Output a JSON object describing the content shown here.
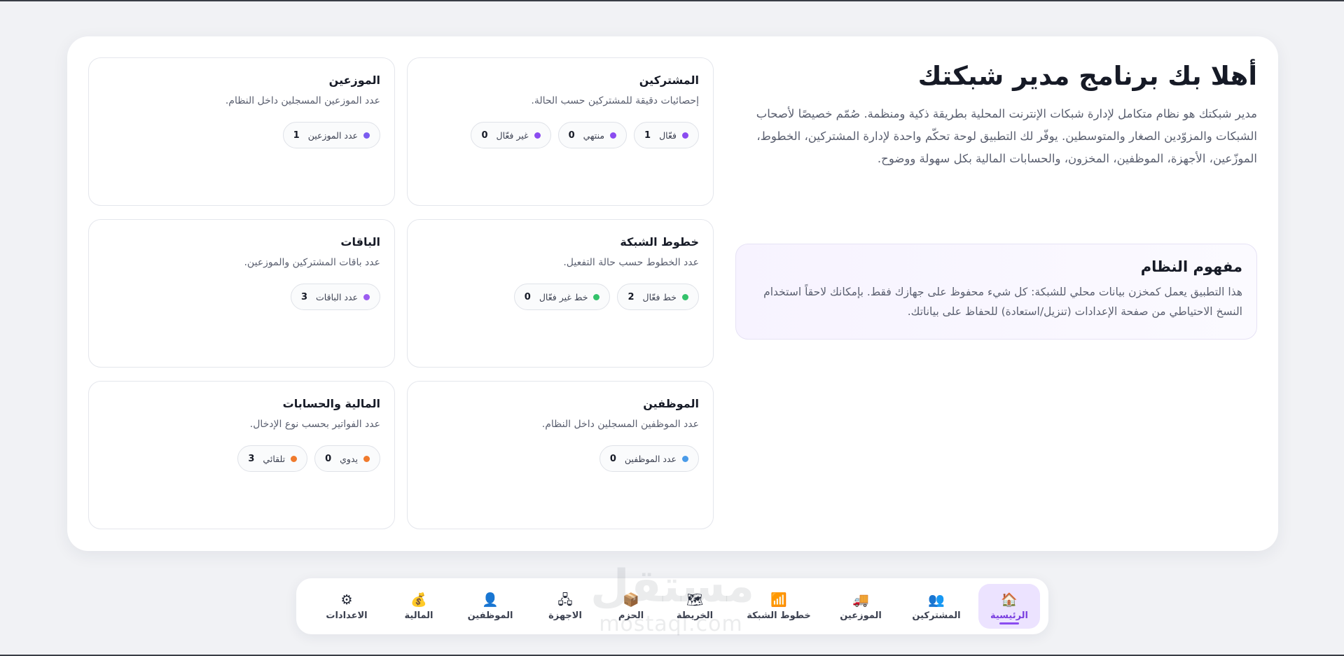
{
  "intro": {
    "title": "أهلا بك برنامج مدير شبكتك",
    "description": "مدير شبكتك هو نظام متكامل لإدارة شبكات الإنترنت المحلية بطريقة ذكية ومنظمة. صُمّم خصيصًا لأصحاب الشبكات والمزوّدين الصغار والمتوسطين. يوفّر لك التطبيق لوحة تحكّم واحدة لإدارة المشتركين، الخطوط، الموزّعين، الأجهزة، الموظفين، المخزون، والحسابات المالية بكل سهولة ووضوح."
  },
  "concept": {
    "title": "مفهوم النظام",
    "text": "هذا التطبيق يعمل كمخزن بيانات محلي للشبكة: كل شيء محفوظ على جهازك فقط. بإمكانك لاحقاً استخدام النسخ الاحتياطي من صفحة الإعدادات (تنزيل/استعادة) للحفاظ على بياناتك."
  },
  "cards": {
    "subscribers": {
      "title": "المشتركين",
      "desc": "إحصائيات دقيقة للمشتركين حسب الحالة.",
      "chips": [
        {
          "label": "فعّال",
          "value": "1",
          "color": "#8b4cf0"
        },
        {
          "label": "منتهي",
          "value": "0",
          "color": "#8b4cf0"
        },
        {
          "label": "غير فعّال",
          "value": "0",
          "color": "#8b4cf0"
        }
      ]
    },
    "distributors": {
      "title": "الموزعين",
      "desc": "عدد الموزعين المسجلين داخل النظام.",
      "chips": [
        {
          "label": "عدد الموزعين",
          "value": "1",
          "color": "#7b5cf0"
        }
      ]
    },
    "lines": {
      "title": "خطوط الشبكة",
      "desc": "عدد الخطوط حسب حالة التفعيل.",
      "chips": [
        {
          "label": "خط فعّال",
          "value": "2",
          "color": "#34c26b"
        },
        {
          "label": "خط غير فعّال",
          "value": "0",
          "color": "#34c26b"
        }
      ]
    },
    "packages": {
      "title": "الباقات",
      "desc": "عدد باقات المشتركين والموزعين.",
      "chips": [
        {
          "label": "عدد الباقات",
          "value": "3",
          "color": "#9b5cf0"
        }
      ]
    },
    "employees": {
      "title": "الموظفين",
      "desc": "عدد الموظفين المسجلين داخل النظام.",
      "chips": [
        {
          "label": "عدد الموظفين",
          "value": "0",
          "color": "#4a9be8"
        }
      ]
    },
    "finance": {
      "title": "المالية والحسابات",
      "desc": "عدد الفواتير بحسب نوع الإدخال.",
      "chips": [
        {
          "label": "يدوي",
          "value": "0",
          "color": "#f07a2c"
        },
        {
          "label": "تلقائي",
          "value": "3",
          "color": "#f07a2c"
        }
      ]
    }
  },
  "nav": {
    "items": [
      {
        "label": "الرئيسية",
        "icon": "🏠",
        "icon_name": "home-icon"
      },
      {
        "label": "المشتركين",
        "icon": "👥",
        "icon_name": "users-icon"
      },
      {
        "label": "الموزعين",
        "icon": "🚚",
        "icon_name": "truck-icon"
      },
      {
        "label": "خطوط الشبكة",
        "icon": "📶",
        "icon_name": "signal-icon"
      },
      {
        "label": "الخريطة",
        "icon": "🗺",
        "icon_name": "map-icon"
      },
      {
        "label": "الحزم",
        "icon": "📦",
        "icon_name": "package-icon"
      },
      {
        "label": "الاجهزة",
        "icon": "🖧",
        "icon_name": "network-devices-icon"
      },
      {
        "label": "الموظفين",
        "icon": "👤",
        "icon_name": "employee-icon"
      },
      {
        "label": "المالية",
        "icon": "💰",
        "icon_name": "money-bag-icon"
      },
      {
        "label": "الاعدادات",
        "icon": "⚙",
        "icon_name": "gear-icon"
      }
    ]
  },
  "watermark": {
    "ar": "مستقل",
    "en": "mostaql.com"
  }
}
